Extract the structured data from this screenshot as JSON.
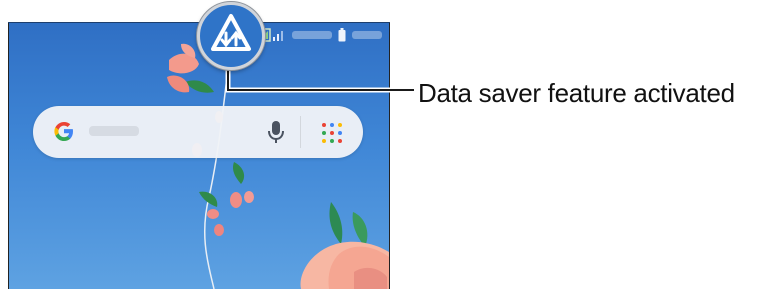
{
  "callout": {
    "label": "Data saver feature activated"
  },
  "status_bar": {
    "icons": [
      "data-saver-icon",
      "signal-icon",
      "battery-icon"
    ]
  },
  "search_widget": {
    "logo": "google-logo",
    "mic": "mic-icon",
    "apps": "apps-grid-icon"
  },
  "colors": {
    "wallpaper_top": "#2f6fc4",
    "wallpaper_bottom": "#5ea2e2",
    "callout_line": "#1a1a1a",
    "lens_border": "#d0d4da"
  }
}
